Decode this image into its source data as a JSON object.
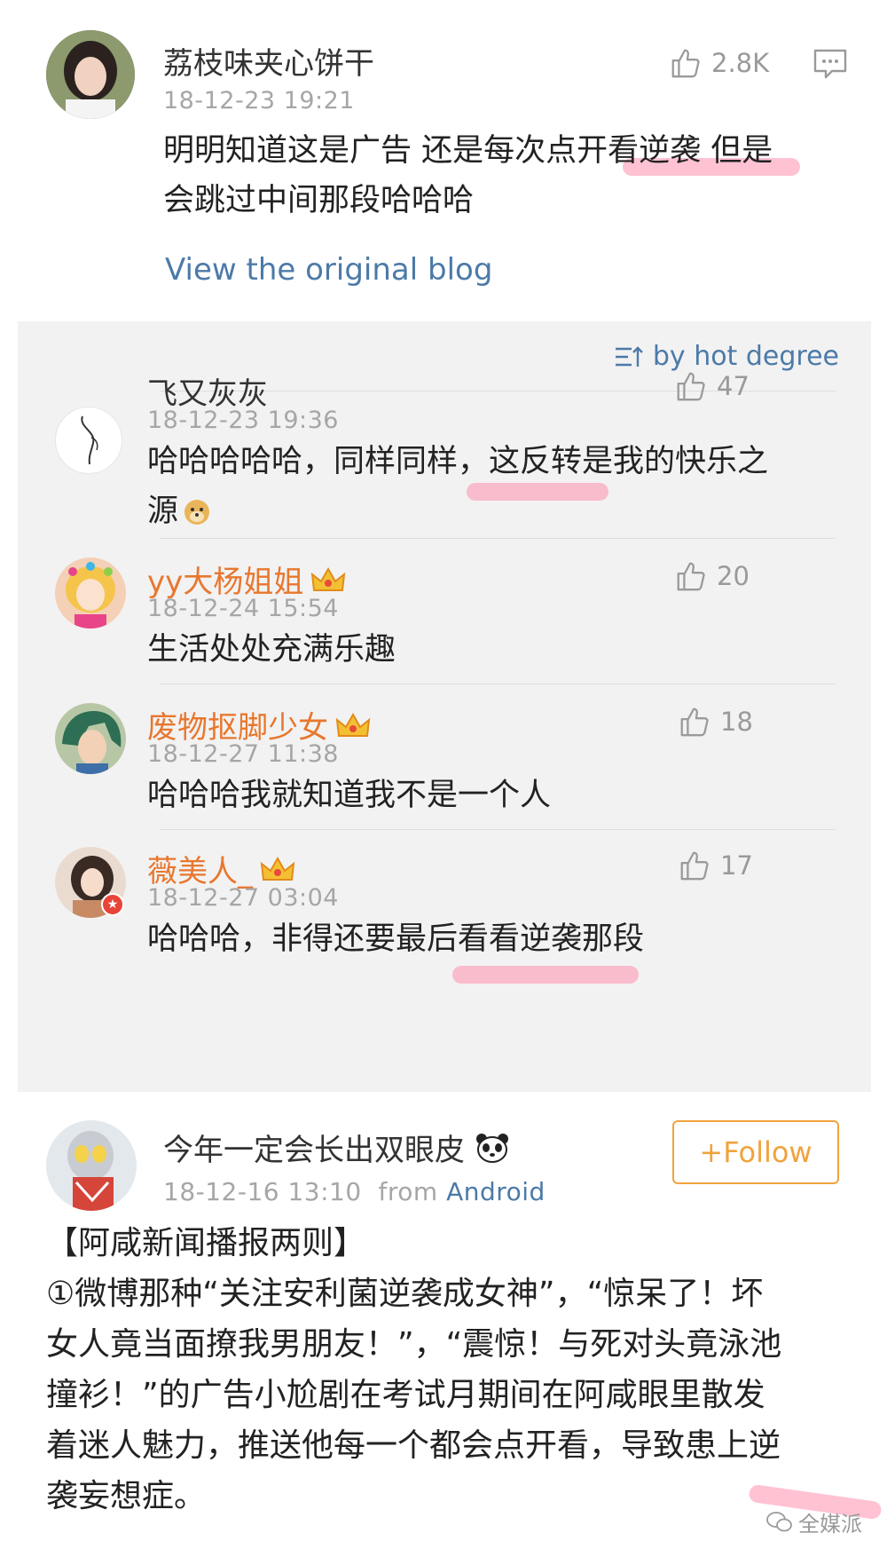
{
  "top_comment": {
    "username": "荔枝味夹心饼干",
    "timestamp": "18-12-23 19:21",
    "likes": "2.8K",
    "text_line1": "明明知道这是广告 还是每次点开看逆袭 但是",
    "text_line2": "会跳过中间那段哈哈哈",
    "view_original": "View the original blog"
  },
  "reply_panel": {
    "sort_label": "by hot degree",
    "replies": [
      {
        "username": "飞又灰灰",
        "timestamp": "18-12-23 19:36",
        "likes": "47",
        "text_line1": "哈哈哈哈哈，同样同样，这反转是我的快乐之",
        "text_line2": "源"
      },
      {
        "username": "yy大杨姐姐",
        "timestamp": "18-12-24 15:54",
        "likes": "20",
        "text_line1": "生活处处充满乐趣"
      },
      {
        "username": "废物抠脚少女",
        "timestamp": "18-12-27 11:38",
        "likes": "18",
        "text_line1": "哈哈哈我就知道我不是一个人"
      },
      {
        "username": "薇美人_",
        "timestamp": "18-12-27 03:04",
        "likes": "17",
        "text_line1": "哈哈哈，非得还要最后看看逆袭那段"
      }
    ]
  },
  "post": {
    "username": "今年一定会长出双眼皮",
    "timestamp": "18-12-16 13:10",
    "from_label": "from",
    "source": "Android",
    "follow_label": "+Follow",
    "body_lines": [
      "【阿咸新闻播报两则】",
      "①微博那种“关注安利菌逆袭成女神”，“惊呆了！坏",
      "女人竟当面撩我男朋友！”，“震惊！与死对头竟泳池",
      "撞衫！”的广告小尬剧在考试月期间在阿咸眼里散发",
      "着迷人魅力，推送他每一个都会点开看，导致患上逆",
      "袭妄想症。"
    ]
  },
  "watermark": "全媒派",
  "colors": {
    "link": "#4c7aa8",
    "vip_name": "#e8772e",
    "follow": "#f0a33d",
    "highlight": "#ff8fae",
    "panel_bg": "#f2f2f2"
  }
}
